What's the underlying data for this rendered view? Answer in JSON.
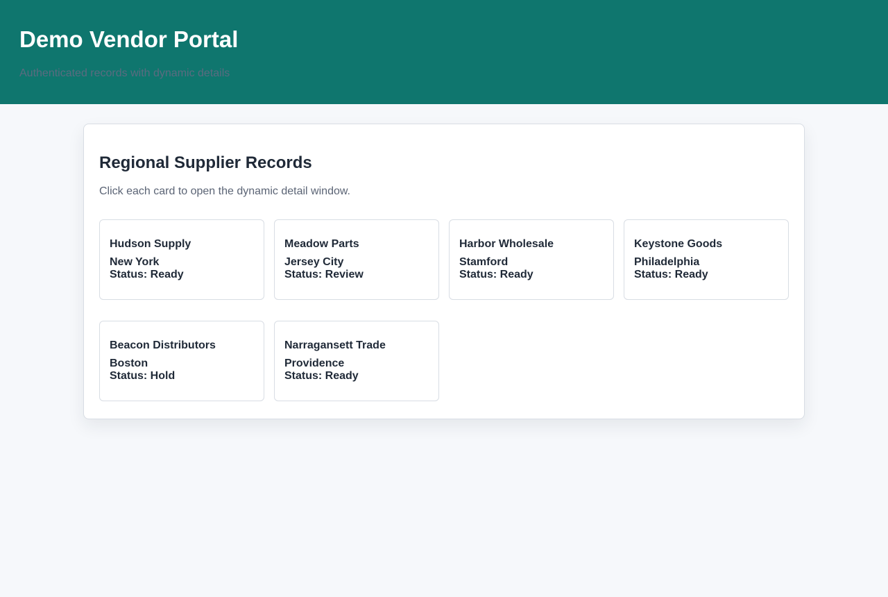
{
  "header": {
    "title": "Demo Vendor Portal",
    "subtitle": "Authenticated records with dynamic details"
  },
  "panel": {
    "title": "Regional Supplier Records",
    "description": "Click each card to open the dynamic detail window."
  },
  "cards": [
    {
      "name": "Hudson Supply",
      "city": "New York",
      "status": "Status: Ready"
    },
    {
      "name": "Meadow Parts",
      "city": "Jersey City",
      "status": "Status: Review"
    },
    {
      "name": "Harbor Wholesale",
      "city": "Stamford",
      "status": "Status: Ready"
    },
    {
      "name": "Keystone Goods",
      "city": "Philadelphia",
      "status": "Status: Ready"
    },
    {
      "name": "Beacon Distributors",
      "city": "Boston",
      "status": "Status: Hold"
    },
    {
      "name": "Narragansett Trade",
      "city": "Providence",
      "status": "Status: Ready"
    }
  ],
  "colors": {
    "header_bg": "#0f766e",
    "page_bg": "#f6f8fb",
    "text": "#1f2937"
  }
}
